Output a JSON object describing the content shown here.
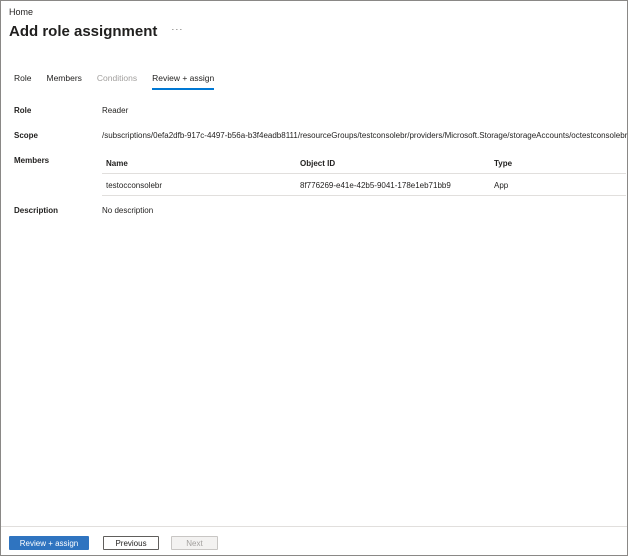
{
  "breadcrumb": {
    "home": "Home"
  },
  "header": {
    "title": "Add role assignment",
    "more": "···"
  },
  "tabs": [
    {
      "label": "Role",
      "state": "normal"
    },
    {
      "label": "Members",
      "state": "normal"
    },
    {
      "label": "Conditions",
      "state": "disabled"
    },
    {
      "label": "Review + assign",
      "state": "active"
    }
  ],
  "review": {
    "role_label": "Role",
    "role_value": "Reader",
    "scope_label": "Scope",
    "scope_value": "/subscriptions/0efa2dfb-917c-4497-b56a-b3f4eadb8111/resourceGroups/testconsolebr/providers/Microsoft.Storage/storageAccounts/octestconsolebr",
    "members_label": "Members",
    "members_table": {
      "columns": [
        "Name",
        "Object ID",
        "Type"
      ],
      "rows": [
        [
          "testocconsolebr",
          "8f776269-e41e-42b5-9041-178e1eb71bb9",
          "App"
        ]
      ]
    },
    "description_label": "Description",
    "description_value": "No description"
  },
  "footer": {
    "review_assign": "Review + assign",
    "previous": "Previous",
    "next": "Next"
  },
  "colors": {
    "accent": "#0078d4",
    "primary_button": "#2f74c0",
    "disabled_text": "#a19f9d"
  }
}
